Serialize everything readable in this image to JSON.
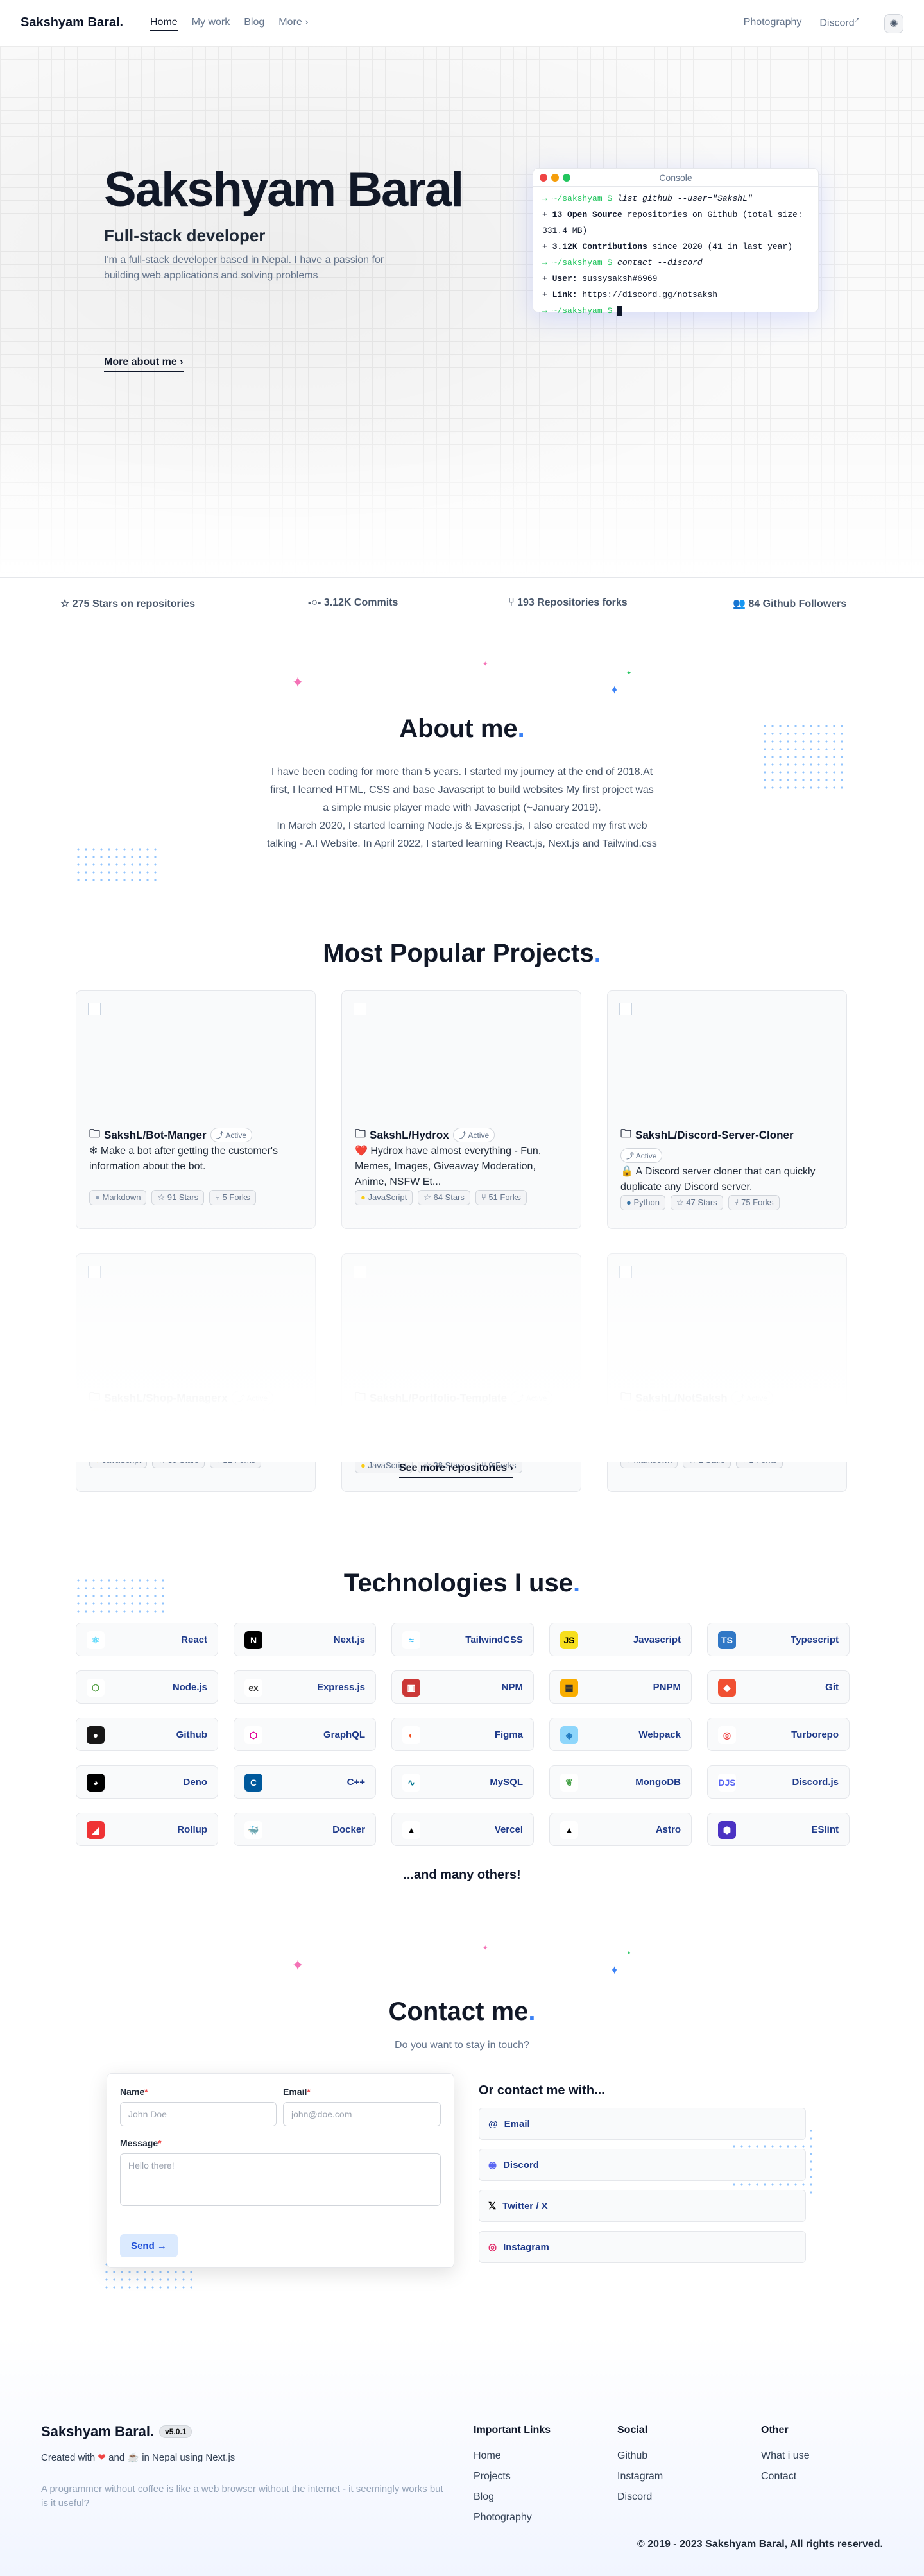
{
  "header": {
    "logo": "Sakshyam Baral.",
    "nav": [
      "Home",
      "My work",
      "Blog",
      "More"
    ],
    "right": [
      "Photography",
      "Discord"
    ]
  },
  "hero": {
    "title": "Sakshyam Baral",
    "subtitle": "Full-stack developer",
    "desc": "I'm a full-stack developer based in Nepal. I have a passion for building web applications and solving problems",
    "more": "More about me"
  },
  "console": {
    "title": "Console",
    "prompt": "~/sakshyam $",
    "cmd1": "list github --user=\"SakshL\"",
    "l1a": "13 Open Source",
    "l1b": " repositories on Github (total size: 331.4 MB)",
    "l2a": "3.12K Contributions",
    "l2b": " since 2020 (41 in last year)",
    "cmd2": "contact --discord",
    "l3a": "User:",
    "l3b": " sussysaksh#6969",
    "l4a": "Link:",
    "l4b": " https://discord.gg/notsaksh"
  },
  "stats": [
    "275 Stars on repositories",
    "3.12K Commits",
    "193 Repositories forks",
    "84 Github Followers"
  ],
  "about": {
    "title": "About me",
    "p1": "I have been coding for more than 5 years. I started my journey at the end of 2018.At first, I learned HTML, CSS and base Javascript to build websites My first project was a simple music player made with Javascript (~January 2019).",
    "p2": "In March 2020, I started learning Node.js & Express.js, I also created my first web talking - A.I Website. In April 2022, I started learning React.js, Next.js and Tailwind.css"
  },
  "projects": {
    "title": "Most Popular Projects",
    "status": "Active",
    "items": [
      {
        "name": "SakshL/Bot-Manger",
        "desc": "❄ Make a bot after getting the customer's information about the bot.",
        "lang": "Markdown",
        "stars": "91 Stars",
        "forks": "5 Forks"
      },
      {
        "name": "SakshL/Hydrox",
        "desc": "❤️ Hydrox have almost everything - Fun, Memes, Images, Giveaway Moderation, Anime, NSFW Et...",
        "lang": "JavaScript",
        "stars": "64 Stars",
        "forks": "51 Forks"
      },
      {
        "name": "SakshL/Discord-Server-Cloner",
        "desc": "🔒 A Discord server cloner that can quickly duplicate any Discord server.",
        "lang": "Python",
        "stars": "47 Stars",
        "forks": "75 Forks"
      },
      {
        "name": "SakshL/Shop-Managerx",
        "desc": "😊 You can create a discord bot directly from private messaging or website control with th...",
        "lang": "JavaScript",
        "stars": "39 Stars",
        "forks": "12 Forks"
      },
      {
        "name": "SakshL/Portfolio-Template",
        "desc": "👨‍💻 Software Developer Portfolio Made With React.js",
        "lang": "JavaScript",
        "stars": "28 Stars",
        "forks": "9 Forks"
      },
      {
        "name": "SakshL/NotSaksh",
        "desc": "🔐 PSS! This is a ✨ secret ✨ repo! It's updated every 5 minutes with new stats!",
        "lang": "Markdown",
        "stars": "2 Stars",
        "forks": "1 Forks"
      }
    ],
    "more": "See more repositories"
  },
  "tech": {
    "title": "Technologies I use",
    "items": [
      "React",
      "Next.js",
      "TailwindCSS",
      "Javascript",
      "Typescript",
      "Node.js",
      "Express.js",
      "NPM",
      "PNPM",
      "Git",
      "Github",
      "GraphQL",
      "Figma",
      "Webpack",
      "Turborepo",
      "Deno",
      "C++",
      "MySQL",
      "MongoDB",
      "Discord.js",
      "Rollup",
      "Docker",
      "Vercel",
      "Astro",
      "ESlint"
    ],
    "many": "...and many others!"
  },
  "contact": {
    "title": "Contact me",
    "sub": "Do you want to stay in touch?",
    "name": "Name",
    "email": "Email",
    "name_ph": "John Doe",
    "email_ph": "john@doe.com",
    "message": "Message",
    "msg_ph": "Hello there!",
    "send": "Send",
    "or": "Or contact me with...",
    "links": [
      "Email",
      "Discord",
      "Twitter / X",
      "Instagram"
    ]
  },
  "footer": {
    "logo": "Sakshyam Baral.",
    "ver": "v5.0.1",
    "created_a": "Created with",
    "created_b": "and",
    "created_c": "in Nepal using Next.js",
    "quote": "A programmer without coffee is like a web browser without the internet - it seemingly works but is it useful?",
    "col1": {
      "h": "Important Links",
      "items": [
        "Home",
        "Projects",
        "Blog",
        "Photography"
      ]
    },
    "col2": {
      "h": "Social",
      "items": [
        "Github",
        "Instagram",
        "Discord"
      ]
    },
    "col3": {
      "h": "Other",
      "items": [
        "What i use",
        "Contact"
      ]
    },
    "copy": "© 2019 - 2023 Sakshyam Baral, All rights reserved."
  },
  "colors": {
    "accent": "#3b82f6",
    "green": "#22c55e"
  }
}
